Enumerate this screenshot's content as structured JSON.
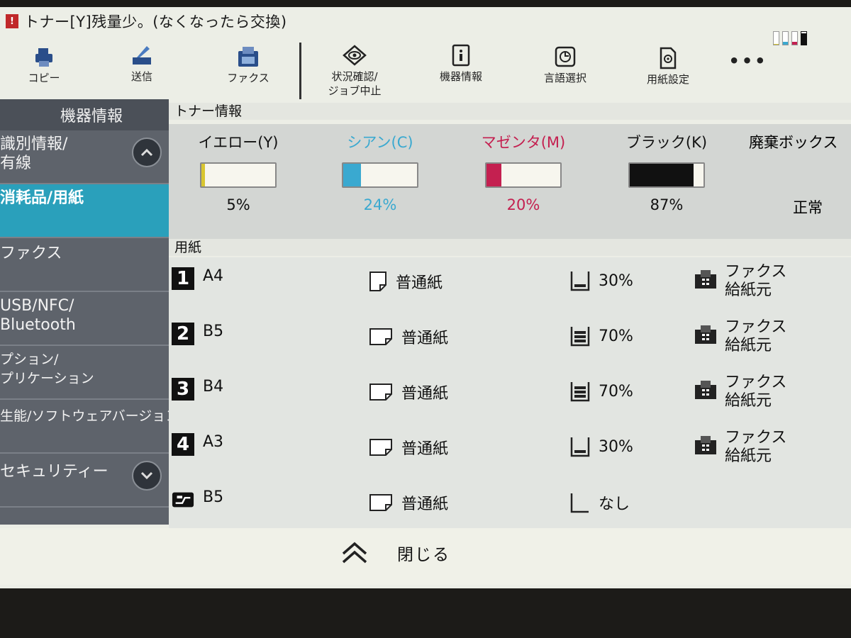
{
  "status": {
    "alert_icon": "!",
    "message": "トナー[Y]残量少。(なくなったら交換)",
    "toner_levels": [
      {
        "color": "#d8c630",
        "level": 0.05
      },
      {
        "color": "#3aa9d0",
        "level": 0.24
      },
      {
        "color": "#c42050",
        "level": 0.2
      },
      {
        "color": "#111111",
        "level": 0.87
      }
    ]
  },
  "toolbar": {
    "copy": "コピー",
    "send": "送信",
    "fax": "ファクス",
    "status_line1": "状況確認/",
    "status_line2": "ジョブ中止",
    "device_info": "機器情報",
    "language": "言語選択",
    "paper_settings": "用紙設定",
    "more": "•••"
  },
  "sidebar": {
    "title": "機器情報",
    "items": [
      {
        "line1": "識別情報/",
        "line2": "有線"
      },
      {
        "line1": "消耗品/用紙",
        "line2": ""
      },
      {
        "line1": "ファクス",
        "line2": ""
      },
      {
        "line1": "USB/NFC/",
        "line2": "Bluetooth"
      },
      {
        "line1": "プション/",
        "line2": "プリケーション"
      },
      {
        "line1": "生能/ソフトウェアバージョン",
        "line2": ""
      },
      {
        "line1": "セキュリティー",
        "line2": ""
      }
    ]
  },
  "toner_section": {
    "title": "トナー情報",
    "items": [
      {
        "name": "イエロー(Y)",
        "pct": "5%",
        "level": 0.05,
        "color": "#d8c630",
        "text_color": "#111111"
      },
      {
        "name": "シアン(C)",
        "pct": "24%",
        "level": 0.24,
        "color": "#3aa9d0",
        "text_color": "#3aa9d0"
      },
      {
        "name": "マゼンタ(M)",
        "pct": "20%",
        "level": 0.2,
        "color": "#c42050",
        "text_color": "#c42050"
      },
      {
        "name": "ブラック(K)",
        "pct": "87%",
        "level": 0.87,
        "color": "#111111",
        "text_color": "#111111"
      }
    ],
    "waste_box": {
      "name": "廃棄ボックス",
      "status": "正常"
    }
  },
  "paper_section": {
    "title": "用紙",
    "trays": [
      {
        "num": "1",
        "size": "A4",
        "type": "普通紙",
        "level": "30%",
        "source_line1": "ファクス",
        "source_line2": "給紙元"
      },
      {
        "num": "2",
        "size": "B5",
        "type": "普通紙",
        "level": "70%",
        "source_line1": "ファクス",
        "source_line2": "給紙元"
      },
      {
        "num": "3",
        "size": "B4",
        "type": "普通紙",
        "level": "70%",
        "source_line1": "ファクス",
        "source_line2": "給紙元"
      },
      {
        "num": "4",
        "size": "A3",
        "type": "普通紙",
        "level": "30%",
        "source_line1": "ファクス",
        "source_line2": "給紙元"
      },
      {
        "num": "",
        "size": "B5",
        "type": "普通紙",
        "level": "なし",
        "source_line1": "",
        "source_line2": ""
      }
    ]
  },
  "footer": {
    "close_label": "閉じる"
  }
}
